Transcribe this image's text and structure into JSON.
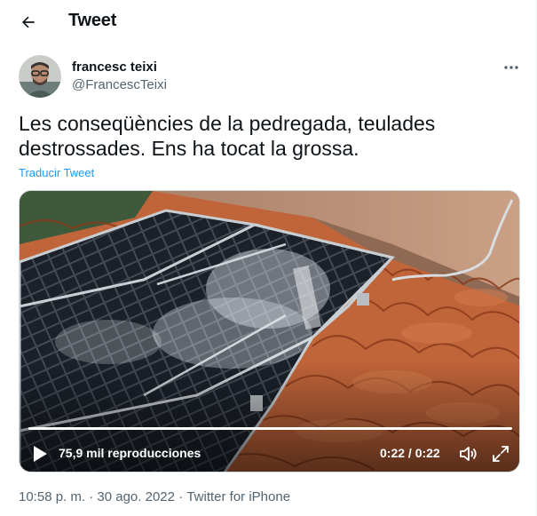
{
  "header": {
    "title": "Tweet",
    "back_icon": "arrow-left-icon"
  },
  "author": {
    "name": "francesc teixi",
    "handle": "@FrancescTeixi"
  },
  "more_icon": "more-horizontal-icon",
  "tweet": {
    "text": "Les conseqüències de la pedregada, teulades destrossades. Ens ha tocat la grossa.",
    "translate_label": "Traducir Tweet"
  },
  "video": {
    "views": "75,9 mil reproducciones",
    "time": "0:22 / 0:22",
    "progress": 1.0,
    "play_icon": "play-icon",
    "volume_icon": "volume-icon",
    "fullscreen_icon": "fullscreen-icon"
  },
  "meta": {
    "time": "10:58 p. m.",
    "separator": "·",
    "date": "30 ago. 2022",
    "source": "Twitter for iPhone"
  },
  "colors": {
    "accent": "#1d9bf0",
    "secondary_text": "#536471",
    "primary_text": "#0f1419"
  }
}
